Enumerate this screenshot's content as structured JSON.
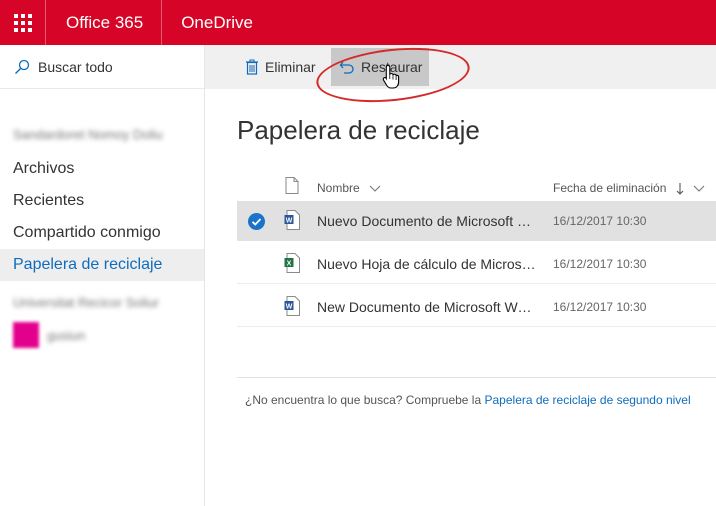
{
  "suite": {
    "brand": "Office 365",
    "app": "OneDrive",
    "accent": "#d60426"
  },
  "nav": {
    "search_label": "Buscar todo",
    "blurred_account": "Sandardoret Nomoy Doliu",
    "items": [
      {
        "label": "Archivos",
        "active": false
      },
      {
        "label": "Recientes",
        "active": false
      },
      {
        "label": "Compartido conmigo",
        "active": false
      },
      {
        "label": "Papelera de reciclaje",
        "active": true
      }
    ],
    "blurred_group": "Universitat Recicor Soliur",
    "blurred_user": "gusiun",
    "active_color": "#0f6cbd"
  },
  "commands": {
    "delete_label": "Eliminar",
    "restore_label": "Restaurar"
  },
  "main": {
    "title": "Papelera de reciclaje",
    "columns": {
      "name": "Nombre",
      "date": "Fecha de eliminación"
    },
    "rows": [
      {
        "name": "Nuevo Documento de Microsoft Word",
        "date": "16/12/2017 10:30",
        "type": "word",
        "selected": true
      },
      {
        "name": "Nuevo Hoja de cálculo de Microsoft Excel",
        "date": "16/12/2017 10:30",
        "type": "excel",
        "selected": false
      },
      {
        "name": "New Documento de Microsoft Word",
        "date": "16/12/2017 10:30",
        "type": "word",
        "selected": false
      }
    ],
    "footer_text": "¿No encuentra lo que busca? Compruebe la",
    "footer_link": "Papelera de reciclaje de segundo nivel"
  },
  "icons": [
    "waffle-icon",
    "search-icon",
    "trash-icon",
    "undo-icon",
    "cursor-icon",
    "document-icon",
    "check-icon",
    "word-icon",
    "excel-icon",
    "sort-arrow-icon",
    "chevron-down-icon"
  ]
}
